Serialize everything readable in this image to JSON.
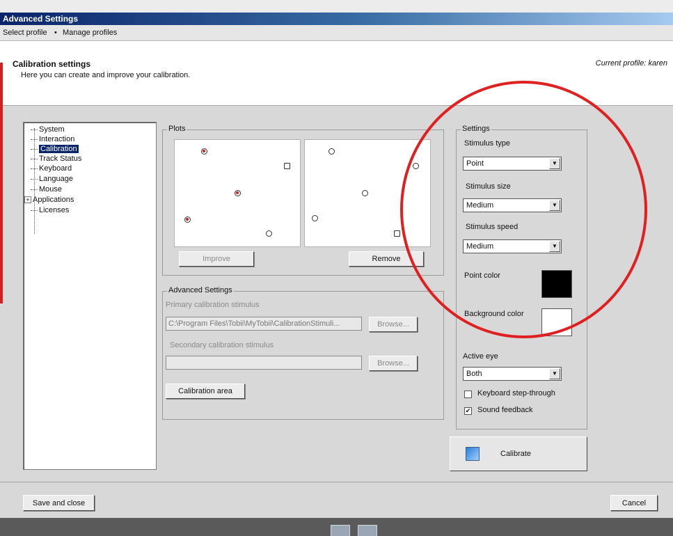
{
  "window": {
    "title": "Advanced Settings"
  },
  "menu": {
    "select_profile": "Select profile",
    "manage_profiles": "Manage profiles",
    "separator": "•"
  },
  "header": {
    "title": "Calibration settings",
    "subtitle": "Here you can create and improve your calibration.",
    "current_profile": "Current profile: karen"
  },
  "nav": {
    "items": [
      "System",
      "Interaction",
      "Calibration",
      "Track Status",
      "Keyboard",
      "Language",
      "Mouse",
      "Applications",
      "Licenses"
    ],
    "selected": "Calibration",
    "expander": "+"
  },
  "plots": {
    "legend": "Plots",
    "improve_label": "Improve",
    "remove_label": "Remove"
  },
  "advanced": {
    "legend": "Advanced Settings",
    "primary_label": "Primary calibration stimulus",
    "primary_value": "C:\\Program Files\\Tobii\\MyTobii\\CalibrationStimuli...",
    "secondary_label": "Secondary calibration stimulus",
    "secondary_value": "",
    "browse_label": "Browse...",
    "calibration_area_label": "Calibration area"
  },
  "settings": {
    "legend": "Settings",
    "stimulus_type_label": "Stimulus type",
    "stimulus_type_value": "Point",
    "stimulus_size_label": "Stimulus size",
    "stimulus_size_value": "Medium",
    "stimulus_speed_label": "Stimulus speed",
    "stimulus_speed_value": "Medium",
    "point_color_label": "Point color",
    "point_color": "#000000",
    "background_color_label": "Background color",
    "background_color": "#ffffff",
    "active_eye_label": "Active eye",
    "active_eye_value": "Both",
    "keyboard_step_label": "Keyboard step-through",
    "keyboard_step_checked": false,
    "sound_feedback_label": "Sound feedback",
    "sound_feedback_checked": true,
    "check_mark": "✔",
    "dropdown_arrow": "▼"
  },
  "actions": {
    "calibrate_label": "Calibrate",
    "save_close_label": "Save and close",
    "cancel_label": "Cancel"
  },
  "colors": {
    "title_bar": "#0a246a",
    "selection": "#0a246a",
    "annotation_circle": "#e02020"
  }
}
